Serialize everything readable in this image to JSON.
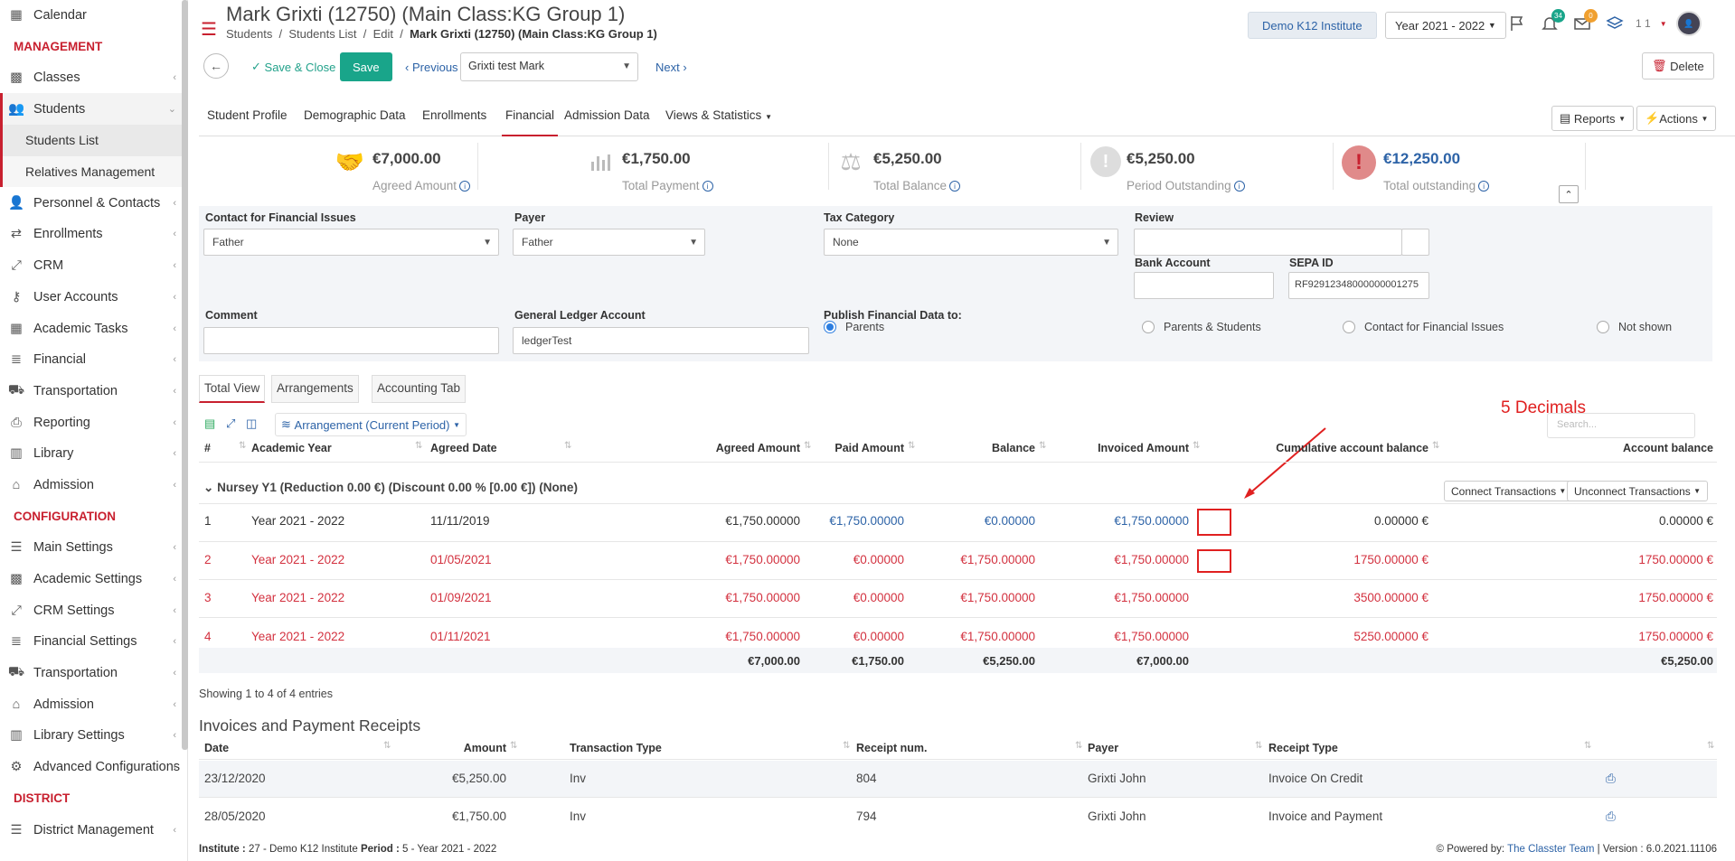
{
  "sidebar": {
    "calendar": "Calendar",
    "management": "MANAGEMENT",
    "classes": "Classes",
    "students": "Students",
    "students_list": "Students List",
    "relatives": "Relatives Management",
    "personnel": "Personnel & Contacts",
    "enrollments": "Enrollments",
    "crm": "CRM",
    "user_accounts": "User Accounts",
    "academic_tasks": "Academic Tasks",
    "financial": "Financial",
    "transportation": "Transportation",
    "reporting": "Reporting",
    "library": "Library",
    "admission": "Admission",
    "configuration": "CONFIGURATION",
    "main_settings": "Main Settings",
    "academic_settings": "Academic Settings",
    "crm_settings": "CRM Settings",
    "financial_settings": "Financial Settings",
    "transportation2": "Transportation",
    "admission2": "Admission",
    "library_settings": "Library Settings",
    "advanced": "Advanced Configurations",
    "district": "DISTRICT",
    "district_mgmt": "District Management"
  },
  "header": {
    "title": "Mark Grixti (12750) (Main Class:KG Group 1)",
    "crumb1": "Students",
    "crumb2": "Students List",
    "crumb3": "Edit",
    "crumb4": "Mark Grixti (12750) (Main Class:KG Group 1)",
    "institute": "Demo K12 Institute",
    "year": "Year 2021 - 2022",
    "bell_count": "34",
    "mail_count": "0",
    "user_num": "1 1"
  },
  "toolbar": {
    "save_close": "Save & Close",
    "save": "Save",
    "previous": "Previous",
    "student": "Grixti test Mark",
    "next": "Next",
    "delete": "Delete"
  },
  "tabs": {
    "t1": "Student Profile",
    "t2": "Demographic Data",
    "t3": "Enrollments",
    "t4": "Financial",
    "t5": "Admission Data",
    "t6": "Views & Statistics",
    "reports": "Reports",
    "actions": "Actions"
  },
  "summary": {
    "agreed": "€7,000.00",
    "agreed_lbl": "Agreed Amount",
    "payment": "€1,750.00",
    "payment_lbl": "Total Payment",
    "balance": "€5,250.00",
    "balance_lbl": "Total Balance",
    "period": "€5,250.00",
    "period_lbl": "Period Outstanding",
    "outstanding": "€12,250.00",
    "outstanding_lbl": "Total outstanding"
  },
  "form": {
    "contact_lbl": "Contact for Financial Issues",
    "contact_val": "Father",
    "payer_lbl": "Payer",
    "payer_val": "Father",
    "tax_lbl": "Tax Category",
    "tax_val": "None",
    "review_lbl": "Review",
    "bank_lbl": "Bank Account",
    "sepa_lbl": "SEPA ID",
    "sepa_val": "RF92912348000000001275",
    "comment_lbl": "Comment",
    "ledger_lbl": "General Ledger Account",
    "ledger_val": "ledgerTest",
    "publish_lbl": "Publish Financial Data to:",
    "opt1": "Parents",
    "opt2": "Parents & Students",
    "opt3": "Contact for Financial Issues",
    "opt4": "Not shown"
  },
  "subtabs": {
    "s1": "Total View",
    "s2": "Arrangements",
    "s3": "Accounting Tab"
  },
  "tools": {
    "arrangement": "Arrangement (Current Period)",
    "search_placeholder": "Search..."
  },
  "annotation": "5 Decimals",
  "table": {
    "headers": {
      "num": "#",
      "year": "Academic Year",
      "date": "Agreed Date",
      "agreed": "Agreed Amount",
      "paid": "Paid Amount",
      "balance": "Balance",
      "invoiced": "Invoiced Amount",
      "cumulative": "Cumulative account balance",
      "account": "Account balance"
    },
    "group": "Nursey Y1 (Reduction 0.00 €) (Discount 0.00 % [0.00 €]) (None)",
    "connect": "Connect Transactions",
    "unconnect": "Unconnect Transactions",
    "rows": [
      {
        "num": "1",
        "year": "Year 2021 - 2022",
        "date": "11/11/2019",
        "agreed": "€1,750.00000",
        "paid": "€1,750.00000",
        "balance": "€0.00000",
        "invoiced": "€1,750.00000",
        "cumulative": "0.00000 €",
        "account": "0.00000 €"
      },
      {
        "num": "2",
        "year": "Year 2021 - 2022",
        "date": "01/05/2021",
        "agreed": "€1,750.00000",
        "paid": "€0.00000",
        "balance": "€1,750.00000",
        "invoiced": "€1,750.00000",
        "cumulative": "1750.00000 €",
        "account": "1750.00000 €"
      },
      {
        "num": "3",
        "year": "Year 2021 - 2022",
        "date": "01/09/2021",
        "agreed": "€1,750.00000",
        "paid": "€0.00000",
        "balance": "€1,750.00000",
        "invoiced": "€1,750.00000",
        "cumulative": "3500.00000 €",
        "account": "1750.00000 €"
      },
      {
        "num": "4",
        "year": "Year 2021 - 2022",
        "date": "01/11/2021",
        "agreed": "€1,750.00000",
        "paid": "€0.00000",
        "balance": "€1,750.00000",
        "invoiced": "€1,750.00000",
        "cumulative": "5250.00000 €",
        "account": "1750.00000 €"
      }
    ],
    "totals": {
      "agreed": "€7,000.00",
      "paid": "€1,750.00",
      "balance": "€5,250.00",
      "invoiced": "€7,000.00",
      "account": "€5,250.00"
    },
    "showing": "Showing 1 to 4 of 4 entries"
  },
  "invoices": {
    "title": "Invoices and Payment Receipts",
    "headers": {
      "date": "Date",
      "amount": "Amount",
      "type": "Transaction Type",
      "receipt": "Receipt num.",
      "payer": "Payer",
      "rtype": "Receipt Type"
    },
    "rows": [
      {
        "date": "23/12/2020",
        "amount": "€5,250.00",
        "type": "Inv",
        "receipt": "804",
        "payer": "Grixti John",
        "rtype": "Invoice On Credit"
      },
      {
        "date": "28/05/2020",
        "amount": "€1,750.00",
        "type": "Inv",
        "receipt": "794",
        "payer": "Grixti John",
        "rtype": "Invoice and Payment"
      }
    ]
  },
  "footer": {
    "institute_lbl": "Institute :",
    "institute_val": "27 - Demo K12 Institute",
    "period_lbl": "Period :",
    "period_val": "5 - Year 2021 - 2022",
    "powered": "Powered by:",
    "team": "The Classter Team",
    "version": "| Version : 6.0.2021.11106"
  }
}
